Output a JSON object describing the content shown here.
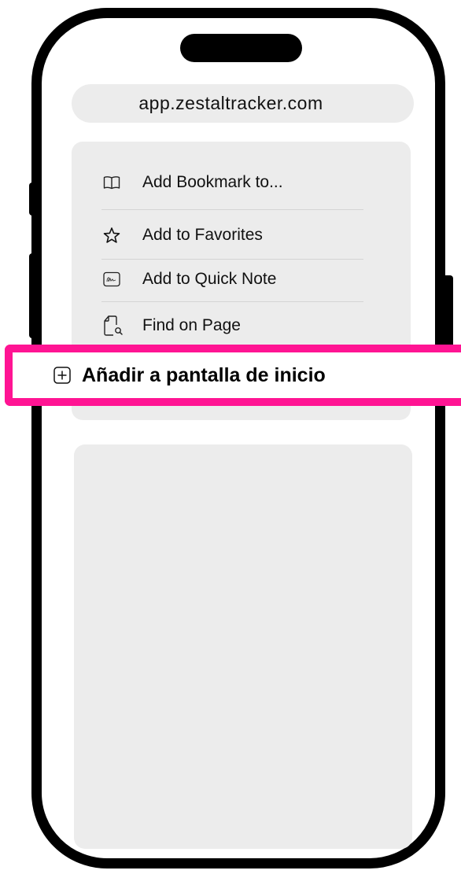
{
  "browser": {
    "url": "app.zestaltracker.com"
  },
  "share_menu": {
    "items": [
      {
        "label": "Add Bookmark to...",
        "icon": "book-icon"
      },
      {
        "label": "Add to Favorites",
        "icon": "star-icon"
      },
      {
        "label": "Add to Quick Note",
        "icon": "quick-note-icon"
      },
      {
        "label": "Find on Page",
        "icon": "find-on-page-icon"
      }
    ],
    "highlighted_item": {
      "label": "Añadir a pantalla de inicio",
      "icon": "plus-square-icon"
    }
  },
  "colors": {
    "highlight_border": "#ff1493",
    "card_background": "#ececec",
    "phone_frame": "#000000"
  }
}
